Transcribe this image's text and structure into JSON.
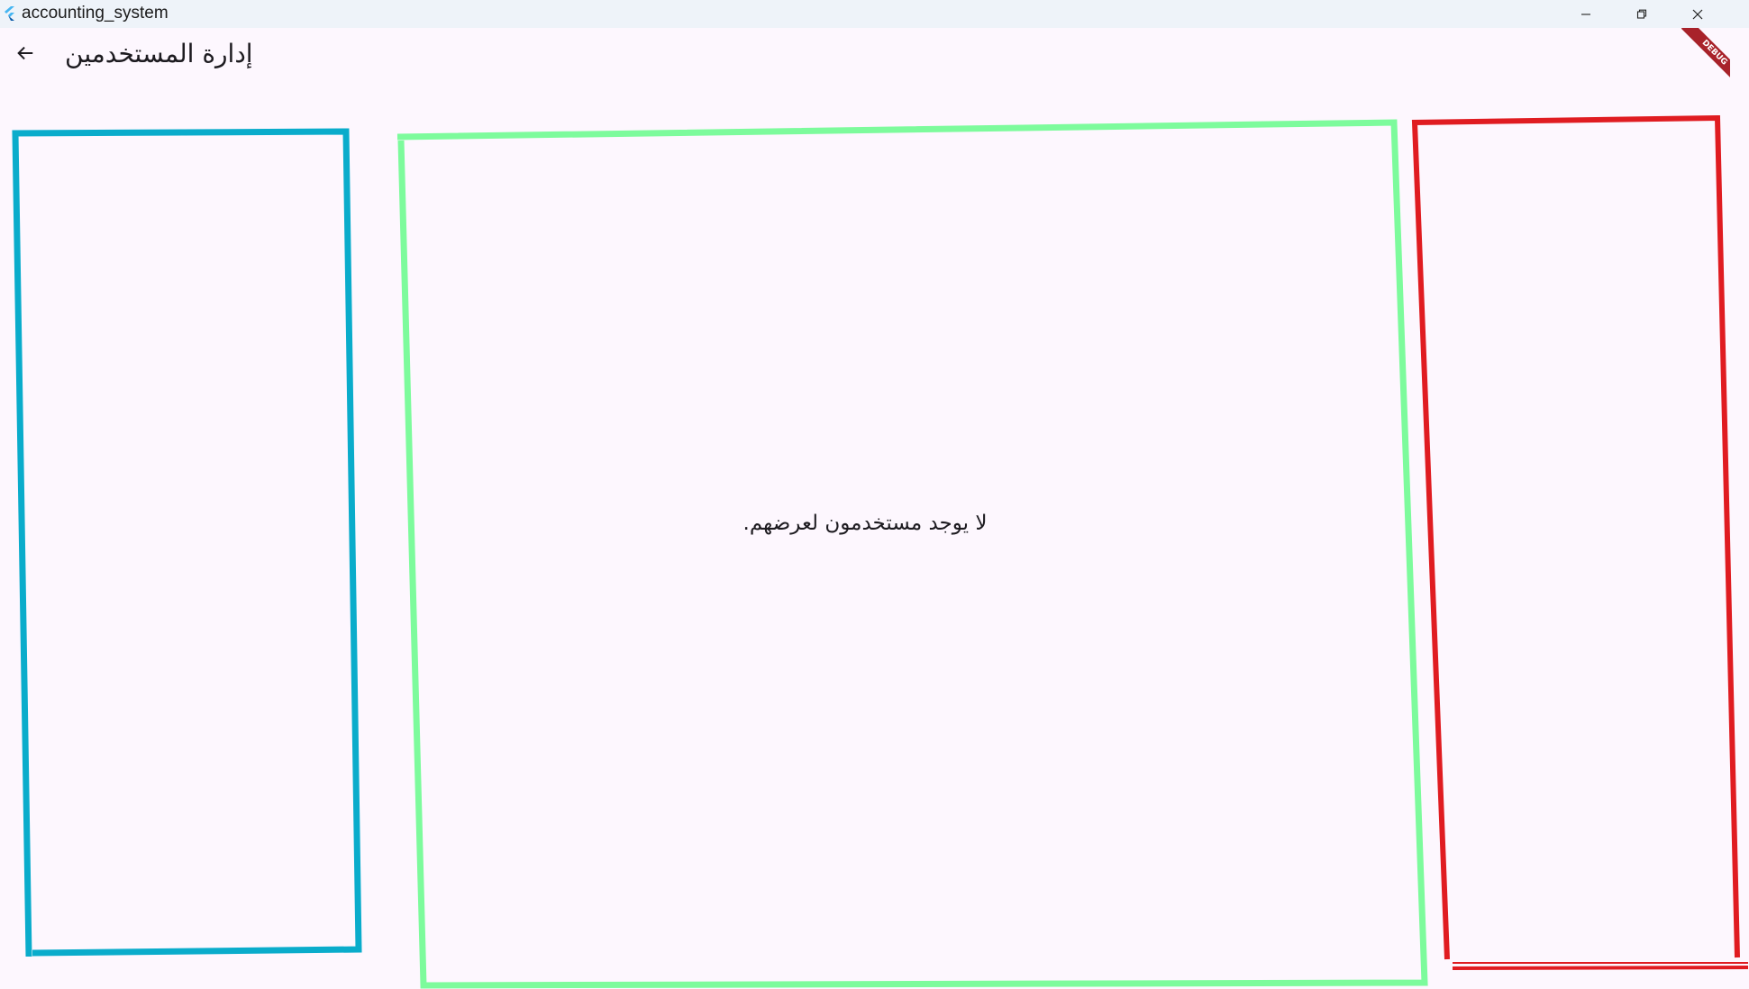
{
  "window": {
    "title": "accounting_system",
    "controls": {
      "minimize": "minimize-icon",
      "maximize": "restore-icon",
      "close": "close-icon"
    }
  },
  "appbar": {
    "back_icon": "arrow-back-icon",
    "title": "إدارة المستخدمين"
  },
  "banner": {
    "label": "DEBUG"
  },
  "main": {
    "empty_message": "لا يوجد مستخدمون لعرضهم."
  },
  "colors": {
    "background": "#fdf7fe",
    "titlebar": "#eef3f9",
    "outline_left": "#0aaccb",
    "outline_center": "#7dfb9c",
    "outline_right": "#e01c21",
    "debug_banner": "#a8222a"
  }
}
